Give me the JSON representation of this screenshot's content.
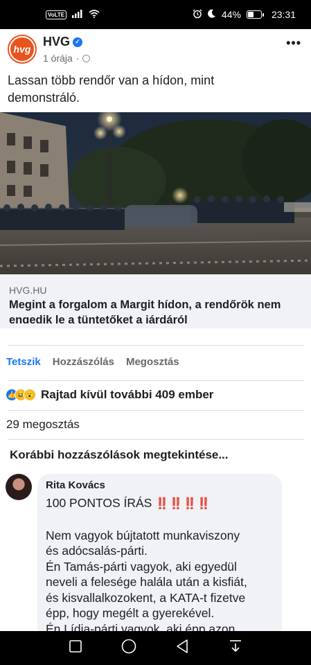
{
  "status_bar": {
    "volte": "VoLTE",
    "battery": "44%",
    "battery_level": 0.44,
    "time": "23:31",
    "icons": [
      "signal-icon",
      "wifi-icon",
      "alarm-icon",
      "moon-icon",
      "battery-icon"
    ]
  },
  "post": {
    "page_name": "HVG",
    "avatar_text": "hvg",
    "time": "1 órája",
    "separator": "·",
    "text_lines": [
      "Lassan több rendőr van a hídon, mint",
      "demonstráló."
    ],
    "link": {
      "domain": "HVG.HU",
      "title": "Megint a forgalom a Margit hídon, a rendőrök nem engedik le a tüntetőket a járdáról"
    }
  },
  "actions": {
    "like": "Tetszik",
    "comment": "Hozzászólás",
    "share": "Megosztás"
  },
  "reactions_text": "Rajtad kívül további 409 ember",
  "shares_text": "29 megosztás",
  "previous_comments": "Korábbi hozzászólások megtekintése...",
  "comment": {
    "author": "Rita Kovács",
    "headline": "100 PONTOS ÍRÁS",
    "emphasis": "‼️‼️‼️‼️",
    "body_lines": [
      "Nem vagyok bújtatott munkaviszony",
      "és adócsalás-párti.",
      "Én Tamás-párti vagyok, aki egyedül",
      "neveli a felesége halála után a kisfiát,",
      "és kisvallalkozokent, a KATA-t fizetve",
      "épp, hogy megélt a gyerekével.",
      "Én Lídia-párti vagyok, aki épp azon"
    ]
  },
  "colors": {
    "brand": "#e9531e",
    "facebook_blue": "#1877f2",
    "text_secondary": "#65676b",
    "bubble": "#f0f2f5"
  }
}
